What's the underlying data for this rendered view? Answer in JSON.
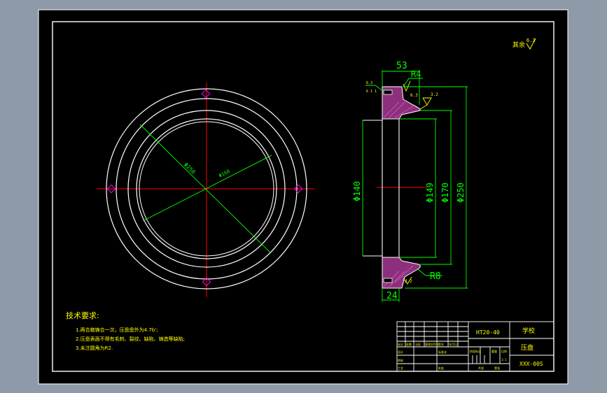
{
  "colors": {
    "background": "#8e9aa7",
    "paper": "#000000",
    "frame": "#ffffff",
    "geometry": "#ffffff",
    "dimension": "#00ff00",
    "centerline": "#ff0000",
    "hatch": "#8e2f7e",
    "text": "#ffff00",
    "symbol": "#ff00ff"
  },
  "roughness_note": {
    "label": "其余",
    "value": "6.3"
  },
  "dimensions": {
    "top_width": "53",
    "top_radius": "R4",
    "bottom_width": "24",
    "bottom_radius": "R8",
    "inner_d140": "Φ140",
    "inner_d149": "Φ149",
    "outer_d170": "Φ170",
    "outer_d250": "Φ250",
    "front_view_d250": "Φ250",
    "front_view_d160": "Φ160",
    "roughness_right": "3.2",
    "roughness_left_top": "6.3",
    "roughness_left_bottom": "3.2",
    "top_small_note_1": "6.3",
    "top_small_note_2": "6 1 1"
  },
  "technical_requirements": {
    "title": "技术要求:",
    "items": [
      "1.两合箱铸合一次，压盘盘外为4.7b';",
      "2.压盘表面不得有毛刺、裂纹、缺陷、铸造等缺陷;",
      "3.未注圆角为R2."
    ]
  },
  "title_block": {
    "material": "HT20-40",
    "school": "学校",
    "part_name": "压盘",
    "drawing_no": "XXX-00S",
    "labels": [
      "标记",
      "处数",
      "分区",
      "更改文件号",
      "签名",
      "年月日",
      "设计",
      "审核",
      "工艺",
      "阶段标记",
      "重量",
      "比例",
      "标准化",
      "批准",
      "共张",
      "第张"
    ],
    "scale_value": "1:1"
  }
}
